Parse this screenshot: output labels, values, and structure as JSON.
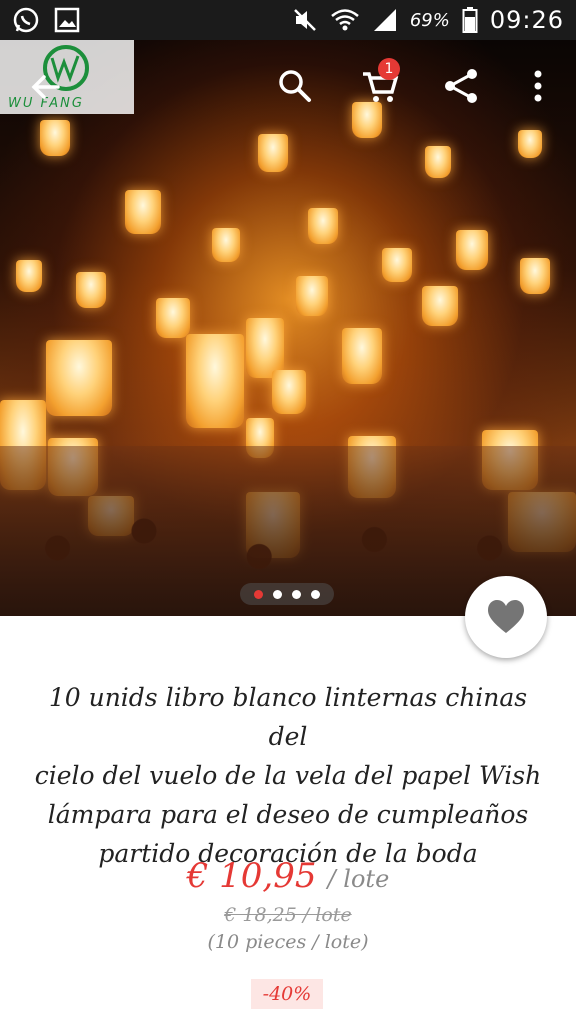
{
  "status_bar": {
    "battery_text": "69%",
    "time": "09:26",
    "icons": [
      "whatsapp-icon",
      "gallery-icon",
      "mute-icon",
      "wifi-icon",
      "signal-icon",
      "battery-icon"
    ]
  },
  "header": {
    "logo_text": "WU FANG",
    "cart_badge": "1",
    "icons": [
      "back-arrow-icon",
      "search-icon",
      "cart-icon",
      "share-icon",
      "more-icon"
    ]
  },
  "gallery": {
    "total_pages": 4,
    "active_page": 1
  },
  "product": {
    "title_lines": [
      "10 unids libro blanco linternas chinas del",
      "cielo del vuelo de la vela del papel Wish",
      "lámpara para el deseo de cumpleaños",
      "partido decoración de la boda"
    ],
    "price": "€ 10,95",
    "price_unit": "/ lote",
    "old_price": "€ 18,25 / lote",
    "pieces": "(10 pieces / lote)",
    "discount": "-40%"
  },
  "colors": {
    "accent": "#e53935",
    "logo_green": "#1c8f3b",
    "status_bar_bg": "#1b1b1b"
  }
}
